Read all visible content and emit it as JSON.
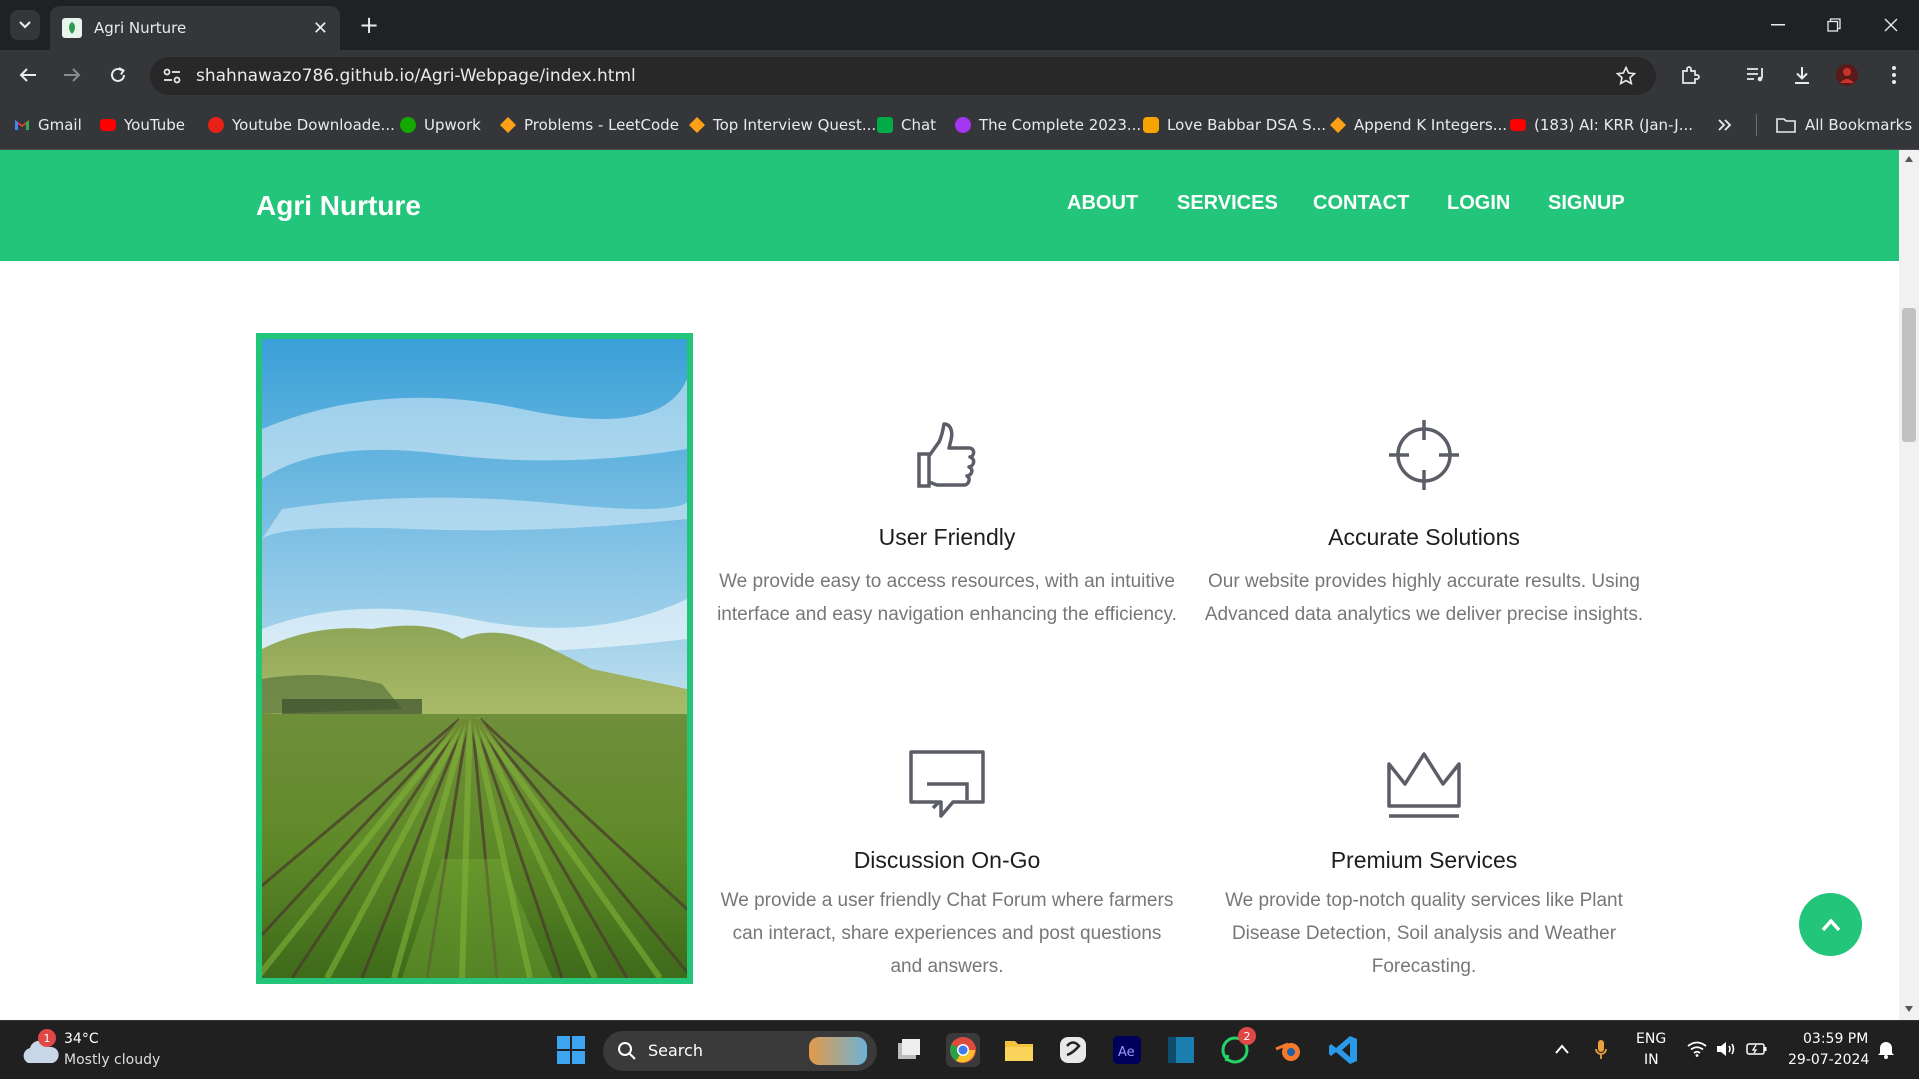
{
  "browser": {
    "tab_title": "Agri Nurture",
    "url": "shahnawazo786.github.io/Agri-Webpage/index.html",
    "bookmarks": [
      "Gmail",
      "YouTube",
      "Youtube Downloade...",
      "Upwork",
      "Problems - LeetCode",
      "Top Interview Quest...",
      "Chat",
      "The Complete 2023...",
      "Love Babbar DSA S...",
      "Append K Integers...",
      "(183) AI: KRR (Jan-J..."
    ],
    "all_bookmarks": "All Bookmarks"
  },
  "site": {
    "brand": "Agri Nurture",
    "menu": [
      "ABOUT",
      "SERVICES",
      "CONTACT",
      "LOGIN",
      "SIGNUP"
    ],
    "features": [
      {
        "icon": "thumbs-up-icon",
        "title": "User Friendly",
        "description": "We provide easy to access resources, with an intuitive interface and easy navigation enhancing the efficiency."
      },
      {
        "icon": "crosshair-icon",
        "title": "Accurate Solutions",
        "description": "Our website provides highly accurate results. Using Advanced data analytics we deliver precise insights."
      },
      {
        "icon": "chat-bubbles-icon",
        "title": "Discussion On-Go",
        "description": "We provide a user friendly Chat Forum where farmers can interact, share experiences and post questions and answers."
      },
      {
        "icon": "crown-icon",
        "title": "Premium Services",
        "description": "We provide top-notch quality services like Plant Disease Detection, Soil analysis and Weather Forecasting."
      }
    ],
    "accent_color": "#22c57a"
  },
  "taskbar": {
    "weather_badge": "1",
    "temperature": "34°C",
    "weather": "Mostly cloudy",
    "search_label": "Search",
    "whatsapp_badge": "2",
    "language": "ENG",
    "region": "IN",
    "time": "03:59 PM",
    "date": "29-07-2024"
  }
}
